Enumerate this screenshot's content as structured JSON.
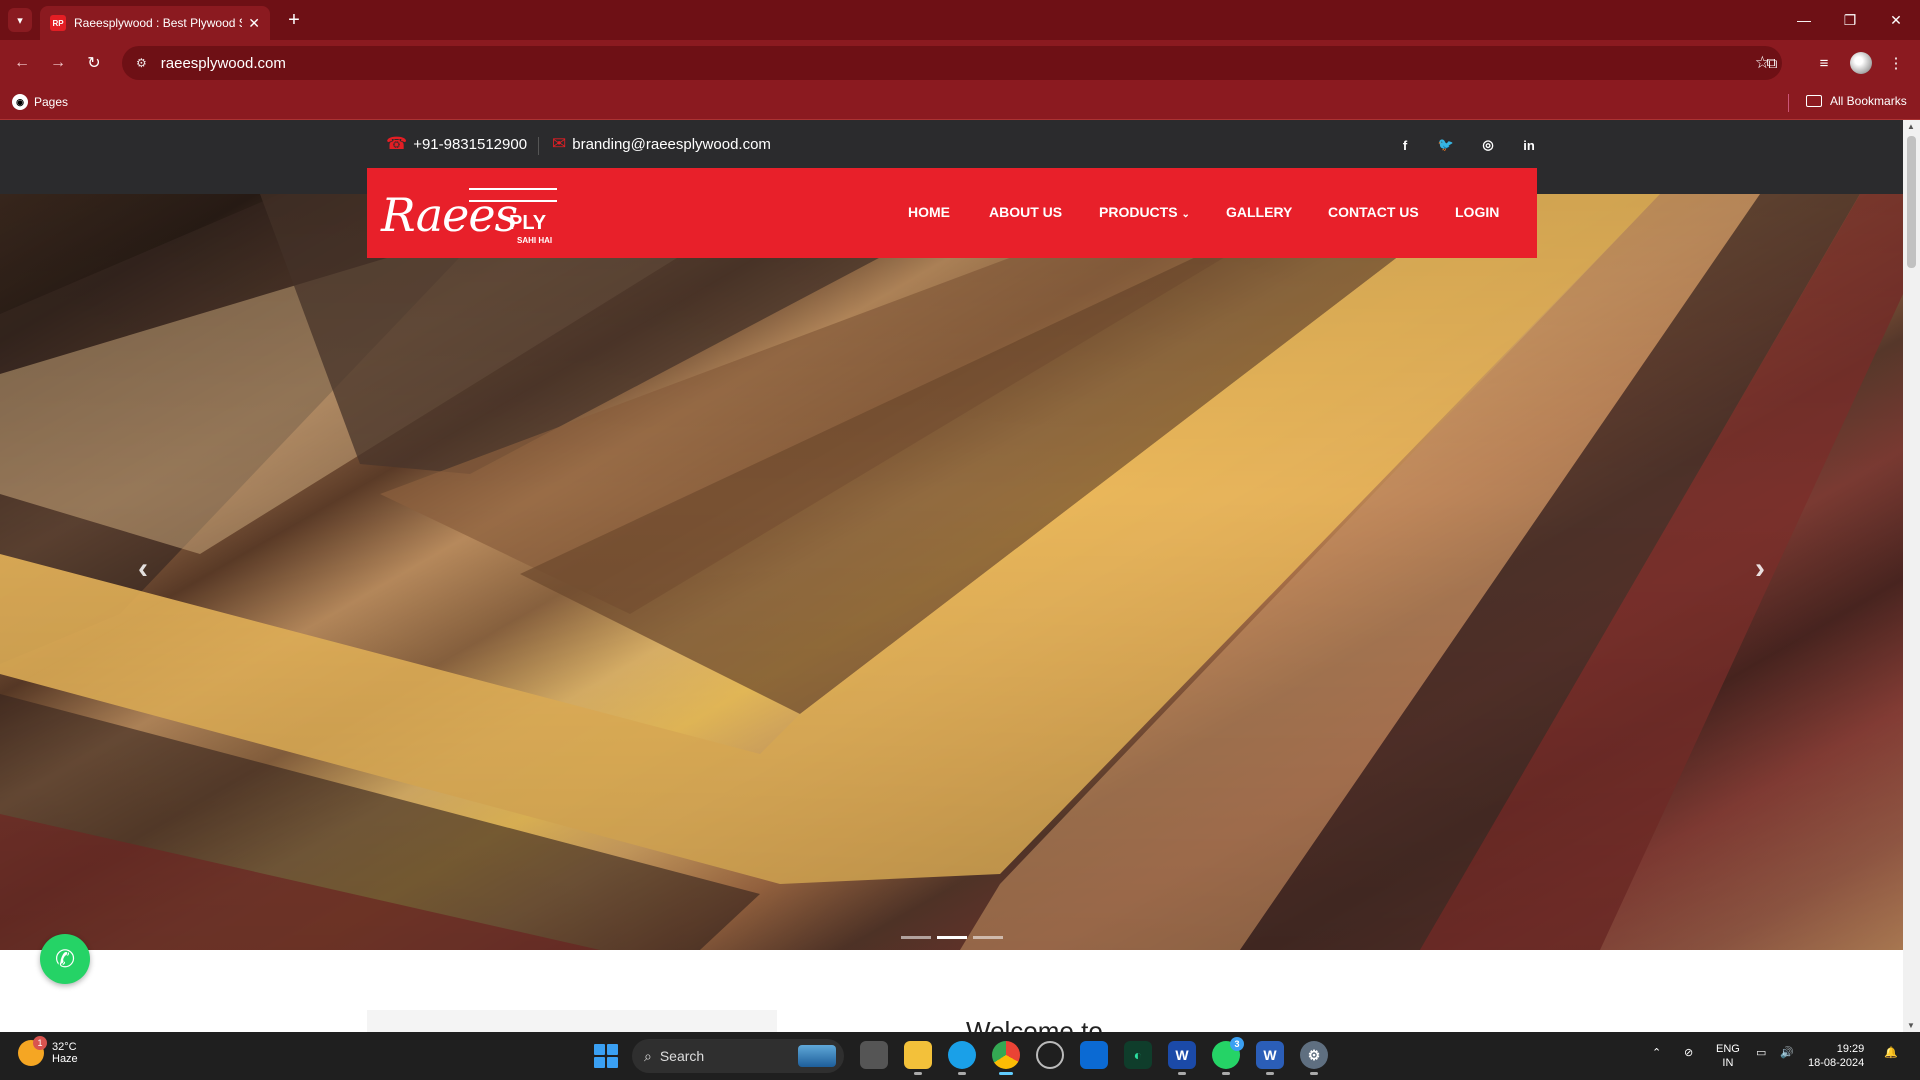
{
  "browser": {
    "tab_title": "Raeesplywood : Best Plywood S",
    "favicon_text": "RP",
    "url": "raeesplywood.com",
    "bookmark_pages": "Pages",
    "bookmark_all": "All Bookmarks",
    "icons": [
      "tab-list-icon",
      "close-icon",
      "new-tab-icon",
      "minimize-icon",
      "restore-icon",
      "close-window-icon",
      "back-icon",
      "forward-icon",
      "reload-icon",
      "site-info-icon",
      "star-icon",
      "extensions-icon",
      "media-icon",
      "profile-avatar",
      "menu-icon",
      "github-icon",
      "folder-icon"
    ]
  },
  "site": {
    "phone": "+91-9831512900",
    "email": "branding@raeesplywood.com",
    "social": [
      {
        "name": "facebook",
        "label": "f"
      },
      {
        "name": "twitter",
        "label": "🐦"
      },
      {
        "name": "instagram",
        "label": "◎"
      },
      {
        "name": "linkedin",
        "label": "in"
      }
    ],
    "logo": {
      "brand": "Raees",
      "ply": "PLY",
      "tagline": "SAHI HAI"
    },
    "menu": [
      {
        "label": "HOME"
      },
      {
        "label": "ABOUT US"
      },
      {
        "label": "PRODUCTS",
        "has_dropdown": true
      },
      {
        "label": "GALLERY"
      },
      {
        "label": "CONTACT US"
      },
      {
        "label": "LOGIN"
      }
    ],
    "carousel": {
      "slides": 3,
      "active_index": 1
    },
    "welcome_text": "Welcome to"
  },
  "taskbar": {
    "weather_temp": "32°C",
    "weather_desc": "Haze",
    "weather_badge": "1",
    "search_placeholder": "Search",
    "whatsapp_badge": "3",
    "lang_top": "ENG",
    "lang_bottom": "IN",
    "time": "19:29",
    "date": "18-08-2024"
  },
  "colors": {
    "browser_frame": "#6e1015",
    "toolbar": "#8b1a20",
    "site_topbar": "#2b2b2d",
    "nav_red": "#e8202a",
    "whatsapp": "#25d366"
  }
}
